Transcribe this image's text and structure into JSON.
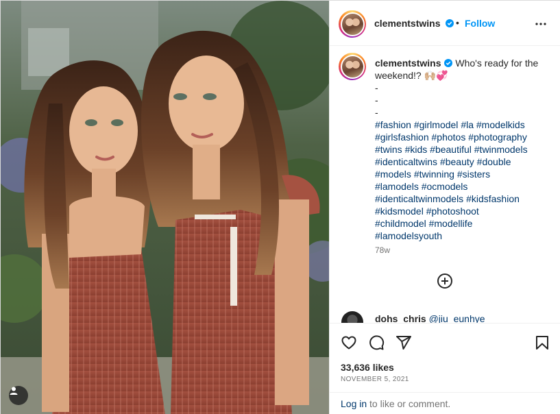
{
  "post": {
    "image_alt": "Two girls in rust dresses",
    "tag_icon": "user-tag-icon"
  },
  "header": {
    "username": "clementstwins",
    "separator": "•",
    "follow_label": "Follow",
    "more_icon": "more-options-icon"
  },
  "caption": {
    "username": "clementstwins",
    "text_line": "Who's ready for the weekend!? 🙌🏼💞",
    "dashes": [
      "-",
      "-",
      "-"
    ],
    "hashtags": [
      "#fashion",
      "#girlmodel",
      "#la",
      "#modelkids",
      "#girlsfashion",
      "#photos",
      "#photography",
      "#twins",
      "#kids",
      "#beautiful",
      "#twinmodels",
      "#identicaltwins",
      "#beauty",
      "#double",
      "#models",
      "#twinning",
      "#sisters",
      "#lamodels",
      "#ocmodels",
      "#identicaltwinmodels",
      "#kidsfashion",
      "#kidsmodel",
      "#photoshoot",
      "#childmodel",
      "#modellife",
      "#lamodelsyouth"
    ],
    "time_ago": "78w"
  },
  "load_more_icon": "plus-circle-icon",
  "comment": {
    "username": "dohs_chris",
    "mention": "@jiu_eunhye"
  },
  "actions": {
    "icons": [
      "heart-icon",
      "comment-icon",
      "share-icon",
      "bookmark-icon"
    ],
    "likes_text": "33,636 likes",
    "date": "NOVEMBER 5, 2021"
  },
  "login": {
    "link": "Log in",
    "rest": " to like or comment."
  },
  "colors": {
    "accent": "#0095f6",
    "link": "#00376b",
    "muted": "#737373",
    "dress": "#a5523f"
  }
}
